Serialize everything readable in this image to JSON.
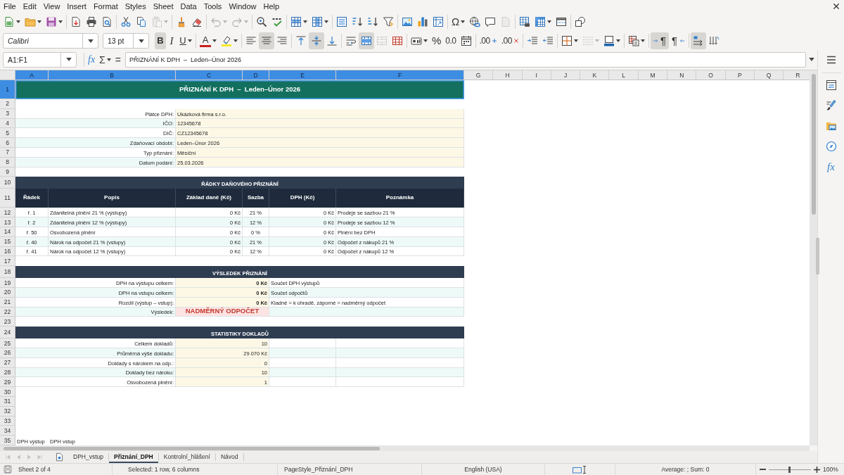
{
  "menu_bar": {
    "items": [
      "File",
      "Edit",
      "View",
      "Insert",
      "Format",
      "Styles",
      "Sheet",
      "Data",
      "Tools",
      "Window",
      "Help"
    ]
  },
  "standard_toolbar": {
    "buttons": [
      {
        "disabled": false
      },
      {
        "disabled": false
      },
      {
        "disabled": false
      },
      {
        "disabled": false
      },
      {
        "disabled": false
      },
      {
        "disabled": false
      },
      {
        "disabled": false
      },
      {
        "disabled": false
      },
      {
        "disabled": true
      },
      {
        "disabled": false
      },
      {
        "disabled": false
      },
      {
        "disabled": true
      },
      {
        "disabled": true
      },
      {
        "disabled": false
      },
      {
        "disabled": false
      },
      {
        "disabled": false
      },
      {
        "disabled": false
      },
      {
        "disabled": false
      },
      {
        "disabled": false
      },
      {
        "disabled": false
      },
      {
        "disabled": false
      },
      {
        "disabled": false
      },
      {
        "disabled": false
      },
      {
        "disabled": false
      },
      {
        "label": "Ω",
        "disabled": false
      },
      {
        "disabled": false
      },
      {
        "disabled": false
      },
      {
        "disabled": true
      },
      {
        "disabled": false
      },
      {
        "disabled": false
      },
      {
        "disabled": false
      },
      {
        "disabled": false
      }
    ]
  },
  "formatting_toolbar": {
    "font_name": "Calibri",
    "font_size": "13 pt",
    "buttons": [
      {
        "label": "B",
        "pressed": true,
        "disabled": false
      },
      {
        "label": "I",
        "pressed": false,
        "disabled": false
      },
      {
        "label": "U",
        "pressed": false,
        "disabled": false
      },
      {
        "label": "A",
        "pressed": false,
        "disabled": false
      },
      {
        "pressed": false,
        "disabled": false
      },
      {
        "pressed": false,
        "disabled": false
      },
      {
        "pressed": true,
        "disabled": false
      },
      {
        "pressed": false,
        "disabled": false
      },
      {
        "pressed": false,
        "disabled": false
      },
      {
        "pressed": true,
        "disabled": false
      },
      {
        "pressed": false,
        "disabled": false
      },
      {
        "pressed": false,
        "disabled": false
      },
      {
        "pressed": true,
        "disabled": false
      },
      {
        "pressed": false,
        "disabled": true
      },
      {
        "pressed": false,
        "disabled": false
      },
      {
        "pressed": false,
        "disabled": false
      },
      {
        "label": "%",
        "pressed": false,
        "disabled": false
      },
      {
        "label": "0.0",
        "pressed": false,
        "disabled": false
      },
      {
        "pressed": false,
        "disabled": false
      },
      {
        "label": ".00",
        "pressed": false,
        "disabled": false
      },
      {
        "label": ".00",
        "pressed": false,
        "disabled": false
      },
      {
        "pressed": false,
        "disabled": false
      },
      {
        "pressed": false,
        "disabled": false
      },
      {
        "pressed": false,
        "disabled": false
      },
      {
        "pressed": false,
        "disabled": true
      },
      {
        "pressed": false,
        "disabled": false
      },
      {
        "pressed": false,
        "disabled": false
      },
      {
        "label": "¶",
        "pressed": true,
        "disabled": false
      },
      {
        "label": "¶",
        "pressed": false,
        "disabled": false
      },
      {
        "pressed": true,
        "disabled": false
      },
      {
        "pressed": false,
        "disabled": false
      }
    ]
  },
  "formula_bar": {
    "name_box": "A1:F1",
    "function_wizard": "fx",
    "sum": "Σ",
    "formula": "=",
    "content": "PŘIZNÁNÍ K DPH  –  Leden–Únor 2026"
  },
  "sheet": {
    "columns": [
      {
        "label": "A",
        "selected": true
      },
      {
        "label": "B",
        "selected": true
      },
      {
        "label": "C",
        "selected": true
      },
      {
        "label": "D",
        "selected": true
      },
      {
        "label": "E",
        "selected": true
      },
      {
        "label": "F",
        "selected": true
      },
      {
        "label": "G",
        "selected": false
      },
      {
        "label": "H",
        "selected": false
      },
      {
        "label": "I",
        "selected": false
      },
      {
        "label": "J",
        "selected": false
      },
      {
        "label": "K",
        "selected": false
      },
      {
        "label": "L",
        "selected": false
      },
      {
        "label": "M",
        "selected": false
      },
      {
        "label": "N",
        "selected": false
      },
      {
        "label": "O",
        "selected": false
      },
      {
        "label": "P",
        "selected": false
      },
      {
        "label": "Q",
        "selected": false
      },
      {
        "label": "R",
        "selected": false
      }
    ],
    "rows": [
      {
        "number": "1",
        "selected": true,
        "kind": "title",
        "text": "PŘIZNÁNÍ K DPH  –  Leden–Únor 2026"
      },
      {
        "number": "2",
        "selected": false,
        "kind": "blank"
      },
      {
        "number": "3",
        "selected": false,
        "kind": "info",
        "label": "Plátce DPH:",
        "value": "Ukázková firma s.r.o."
      },
      {
        "number": "4",
        "selected": false,
        "kind": "info",
        "label": "IČO:",
        "value": "12345678"
      },
      {
        "number": "5",
        "selected": false,
        "kind": "info",
        "label": "DIČ:",
        "value": "CZ12345678"
      },
      {
        "number": "6",
        "selected": false,
        "kind": "info",
        "label": "Zdaňovací období:",
        "value": "Leden–Únor 2026"
      },
      {
        "number": "7",
        "selected": false,
        "kind": "info",
        "label": "Typ přiznání:",
        "value": "Měsíční"
      },
      {
        "number": "8",
        "selected": false,
        "kind": "info",
        "label": "Datum podání:",
        "value": "25.03.2026"
      },
      {
        "number": "9",
        "selected": false,
        "kind": "blank"
      },
      {
        "number": "10",
        "selected": false,
        "kind": "section",
        "text": "ŘÁDKY DAŇOVÉHO PŘIZNÁNÍ"
      },
      {
        "number": "11",
        "selected": false,
        "kind": "table_header",
        "cells": [
          "Řádek",
          "Popis",
          "Základ daně (Kč)",
          "Sazba",
          "DPH (Kč)",
          "Poznámka"
        ]
      },
      {
        "number": "12",
        "selected": false,
        "kind": "table_row",
        "cells": [
          "ř. 1",
          "Zdanitelná plnění 21 % (výstupy)",
          "0 Kč",
          "21 %",
          "0 Kč",
          "Prodeje se sazbou 21 %"
        ]
      },
      {
        "number": "13",
        "selected": false,
        "kind": "table_row",
        "cells": [
          "ř. 2",
          "Zdanitelná plnění 12 % (výstupy)",
          "0 Kč",
          "12 %",
          "0 Kč",
          "Prodeje se sazbou 12 %"
        ]
      },
      {
        "number": "14",
        "selected": false,
        "kind": "table_row",
        "cells": [
          "ř. 50",
          "Osvobozená plnění",
          "0 Kč",
          "0 %",
          "0 Kč",
          "Plnění bez DPH"
        ]
      },
      {
        "number": "15",
        "selected": false,
        "kind": "table_row",
        "cells": [
          "ř. 40",
          "Nárok na odpočet 21 % (vstupy)",
          "0 Kč",
          "21 %",
          "0 Kč",
          "Odpočet z nákupů 21 %"
        ]
      },
      {
        "number": "16",
        "selected": false,
        "kind": "table_row",
        "cells": [
          "ř. 41",
          "Nárok na odpočet 12 % (vstupy)",
          "0 Kč",
          "12 %",
          "0 Kč",
          "Odpočet z nákupů 12 %"
        ]
      },
      {
        "number": "17",
        "selected": false,
        "kind": "blank"
      },
      {
        "number": "18",
        "selected": false,
        "kind": "section",
        "text": "VÝSLEDEK PŘIZNÁNÍ"
      },
      {
        "number": "19",
        "selected": false,
        "kind": "summary",
        "label": "DPH na výstupu celkem:",
        "value": "0 Kč",
        "note": "Součet DPH výstupů"
      },
      {
        "number": "20",
        "selected": false,
        "kind": "summary",
        "label": "DPH na vstupu celkem:",
        "value": "0 Kč",
        "note": "Součet odpočtů"
      },
      {
        "number": "21",
        "selected": false,
        "kind": "summary",
        "label": "Rozdíl (výstup – vstup):",
        "value": "0 Kč",
        "note": "Kladné = k úhradě, záporné = nadměrný odpočet"
      },
      {
        "number": "22",
        "selected": false,
        "kind": "result",
        "label": "Výsledek:",
        "value": "NADMĚRNÝ ODPOČET"
      },
      {
        "number": "23",
        "selected": false,
        "kind": "blank"
      },
      {
        "number": "24",
        "selected": false,
        "kind": "section",
        "text": "STATISTIKY DOKLADŮ"
      },
      {
        "number": "25",
        "selected": false,
        "kind": "stat",
        "label": "Celkem dokladů:",
        "value": "10"
      },
      {
        "number": "26",
        "selected": false,
        "kind": "stat",
        "label": "Průměrná výše dokladu:",
        "value": "29 070 Kč"
      },
      {
        "number": "27",
        "selected": false,
        "kind": "stat",
        "label": "Doklady s nárokem na odp.:",
        "value": "0"
      },
      {
        "number": "28",
        "selected": false,
        "kind": "stat",
        "label": "Doklady bez nároku:",
        "value": "10"
      },
      {
        "number": "29",
        "selected": false,
        "kind": "stat",
        "label": "Osvobozená plnění:",
        "value": "1"
      },
      {
        "number": "30",
        "selected": false,
        "kind": "blank"
      },
      {
        "number": "31",
        "selected": false,
        "kind": "blank"
      },
      {
        "number": "32",
        "selected": false,
        "kind": "blank"
      },
      {
        "number": "33",
        "selected": false,
        "kind": "blank"
      },
      {
        "number": "34",
        "selected": false,
        "kind": "blank"
      },
      {
        "number": "35",
        "selected": false,
        "kind": "plain",
        "cells": [
          "DPH výstup",
          "DPH vstup"
        ]
      }
    ]
  },
  "sheet_tabs": {
    "navigation_disabled": true,
    "tabs": [
      {
        "label": "DPH_vstup",
        "selected": false
      },
      {
        "label": "Přiznání_DPH",
        "selected": true
      },
      {
        "label": "Kontrolní_hlášení",
        "selected": false
      },
      {
        "label": "Návod",
        "selected": false
      }
    ]
  },
  "sidebar": {
    "functions_label": "fx"
  },
  "status_bar": {
    "sheet": "Sheet 2 of 4",
    "selection": "Selected: 1 row, 6 columns",
    "page_style": "PageStyle_Přiznání_DPH",
    "language": "English (USA)",
    "summary": "Average: ; Sum: 0",
    "zoom_slider": {
      "level": 0.5
    },
    "zoom_percent": "100%"
  }
}
